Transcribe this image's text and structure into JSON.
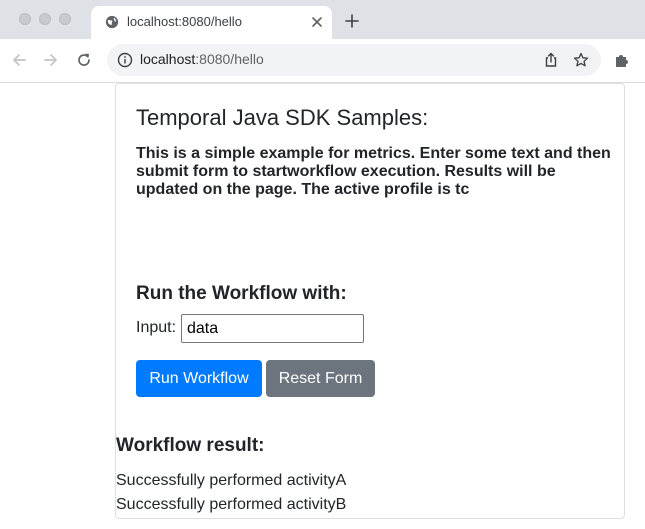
{
  "browser": {
    "tab": {
      "title": "localhost:8080/hello"
    },
    "address": {
      "host": "localhost",
      "path": ":8080/hello"
    }
  },
  "page": {
    "heading": "Temporal Java SDK Samples:",
    "description": "This is a simple example for metrics. Enter some text and then submit form to startworkflow execution. Results will be updated on the page. The active profile is tc",
    "form": {
      "heading": "Run the Workflow with:",
      "input_label": "Input:",
      "input_value": "data",
      "run_button": "Run Workflow",
      "reset_button": "Reset Form"
    },
    "result": {
      "heading": "Workflow result:",
      "lines": [
        "Successfully performed activityA",
        "Successfully performed activityB"
      ]
    }
  },
  "colors": {
    "primary": "#007bff",
    "secondary": "#6c757d",
    "text": "#212529"
  },
  "icons": {
    "favicon": "globe-icon",
    "tab_close": "close-icon",
    "new_tab": "plus-icon",
    "back": "back-arrow-icon",
    "forward": "forward-arrow-icon",
    "reload": "reload-icon",
    "site_info": "info-icon",
    "share": "share-icon",
    "bookmark": "star-icon",
    "extensions": "puzzle-icon"
  }
}
